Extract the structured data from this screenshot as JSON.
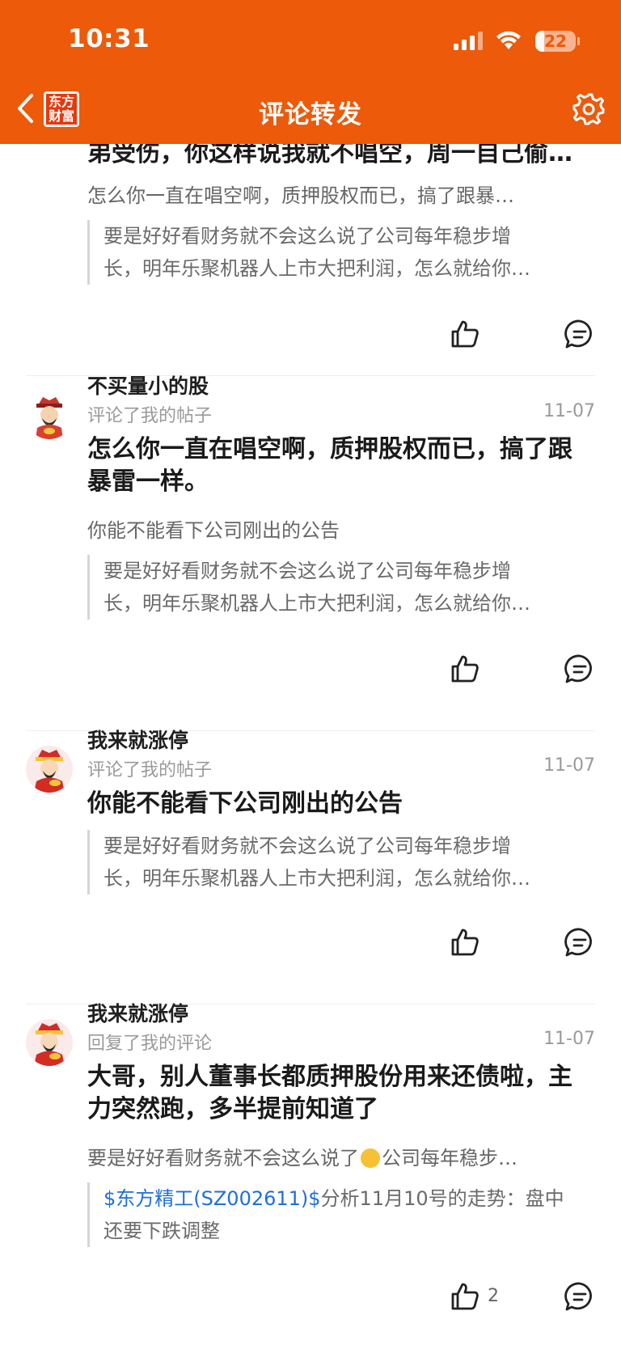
{
  "status_bar": {
    "time": "10:31",
    "battery": "22",
    "battery_level": 0.22
  },
  "header": {
    "title": "评论转发",
    "logo_line1": "东方",
    "logo_line2": "财富"
  },
  "items": [
    {
      "main_text": "弟受伤，你这样说我就不唱空，周一自己偷…",
      "reply_text": "怎么你一直在唱空啊，质押股权而已，搞了跟暴…",
      "quote_line1": "要是好好看财务就不会这么说了公司每年稳步增",
      "quote_line2": "长，明年乐聚机器人上市大把利润，怎么就给你…"
    },
    {
      "user": "不买量小的股",
      "action": "评论了我的帖子",
      "date": "11-07",
      "main_text": "怎么你一直在唱空啊，质押股权而已，搞了跟暴雷一样。",
      "reply_text": "你能不能看下公司刚出的公告",
      "quote_line1": "要是好好看财务就不会这么说了公司每年稳步增",
      "quote_line2": "长，明年乐聚机器人上市大把利润，怎么就给你…"
    },
    {
      "user": "我来就涨停",
      "action": "评论了我的帖子",
      "date": "11-07",
      "main_text": "你能不能看下公司刚出的公告",
      "quote_line1": "要是好好看财务就不会这么说了公司每年稳步增",
      "quote_line2": "长，明年乐聚机器人上市大把利润，怎么就给你…"
    },
    {
      "user": "我来就涨停",
      "action": "回复了我的评论",
      "date": "11-07",
      "main_text": "大哥，别人董事长都质押股份用来还债啦，主力突然跑，多半提前知道了",
      "reply_text_before": "要是好好看财务就不会这么说了",
      "reply_text_after": "公司每年稳步…",
      "quote_stock": "$东方精工(SZ002611)$",
      "quote_rest": "分析11月10号的走势：盘中",
      "quote_line2": "还要下跌调整",
      "like_count": "2"
    }
  ]
}
